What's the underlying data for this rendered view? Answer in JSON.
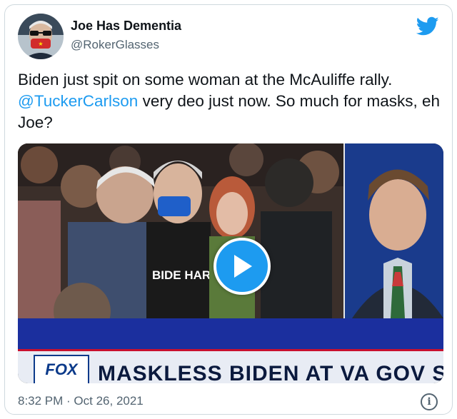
{
  "tweet": {
    "author": {
      "display_name": "Joe Has Dementia",
      "handle": "@RokerGlasses"
    },
    "text": {
      "part1": "Biden just spit on some woman at the McAuliffe rally.  ",
      "mention": "@TuckerCarlson",
      "part2": " very deo just now. So much for masks, eh Joe?"
    },
    "media": {
      "type": "video",
      "chyron": "MASKLESS BIDEN AT VA GOV SUPERSPR",
      "network_logo": "FOX",
      "shirt_text": "BIDE HARR"
    },
    "timestamp": "8:32 PM · Oct 26, 2021"
  },
  "colors": {
    "accent": "#1d9bf0",
    "text": "#0f1419",
    "muted": "#536471",
    "border": "#cfd9de"
  },
  "icons": {
    "brand": "twitter-bird-icon",
    "play": "play-icon",
    "info": "info-icon"
  }
}
